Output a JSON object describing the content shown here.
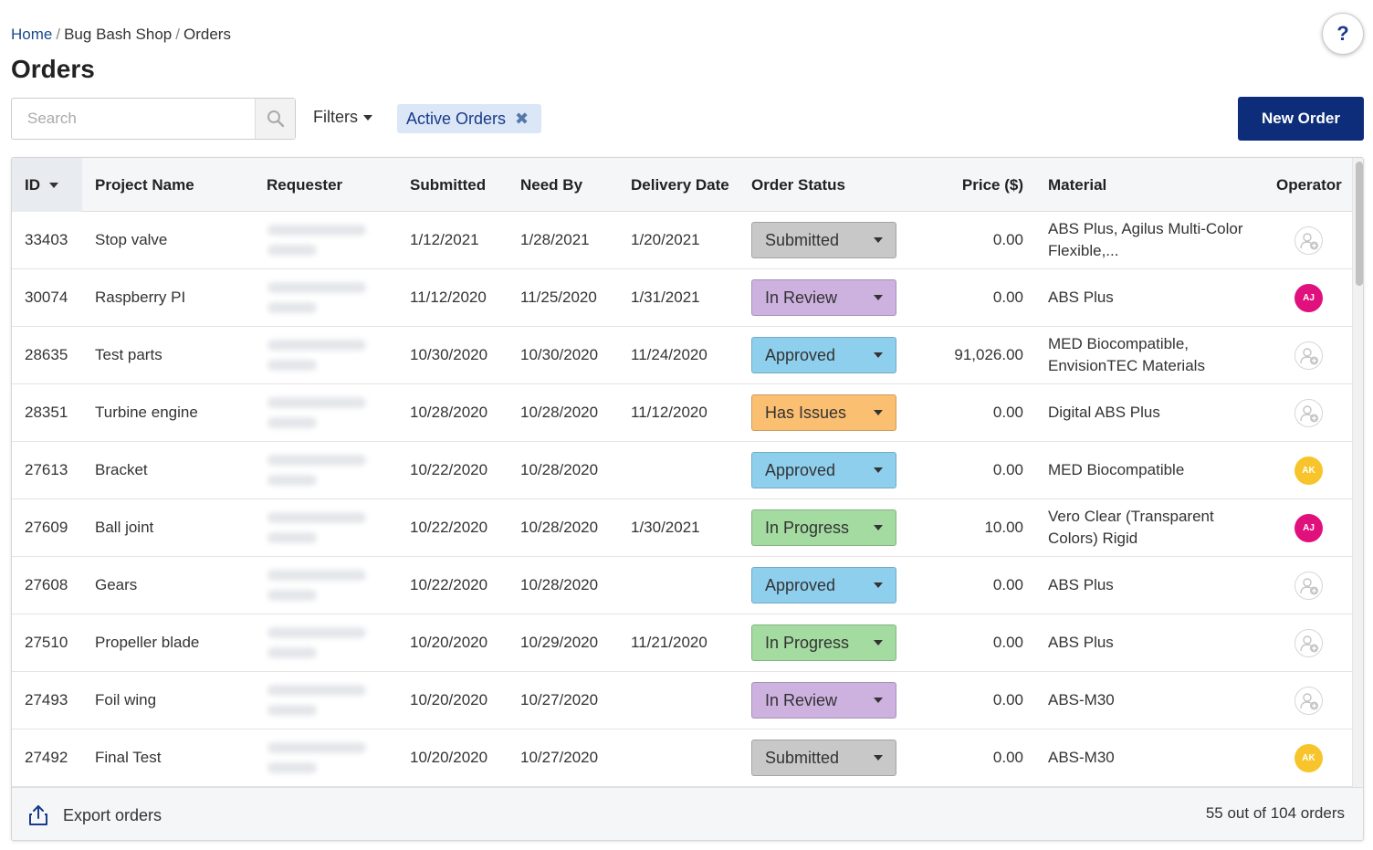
{
  "breadcrumb": {
    "home": "Home",
    "shop": "Bug Bash Shop",
    "current": "Orders",
    "separator": "/"
  },
  "page_title": "Orders",
  "help_label": "?",
  "search": {
    "placeholder": "Search",
    "value": ""
  },
  "filters_label": "Filters",
  "active_filter": {
    "label": "Active Orders",
    "remove_label": "✖"
  },
  "new_order_label": "New Order",
  "columns": {
    "id": "ID",
    "project": "Project Name",
    "requester": "Requester",
    "submitted": "Submitted",
    "need_by": "Need By",
    "delivery": "Delivery Date",
    "status": "Order Status",
    "price": "Price ($)",
    "material": "Material",
    "operator": "Operator"
  },
  "status_colors": {
    "Submitted": "#c8c8c8",
    "In Review": "#cdb1df",
    "Approved": "#8fcfee",
    "Has Issues": "#fbbf72",
    "In Progress": "#a3dba0"
  },
  "operator_colors": {
    "AJ": "#e0107c",
    "AK": "#f7c52b"
  },
  "rows": [
    {
      "id": "33403",
      "project": "Stop valve",
      "submitted": "1/12/2021",
      "need_by": "1/28/2021",
      "delivery": "1/20/2021",
      "status": "Submitted",
      "price": "0.00",
      "material": "ABS Plus, Agilus Multi-Color Flexible,...",
      "operator": ""
    },
    {
      "id": "30074",
      "project": "Raspberry PI",
      "submitted": "11/12/2020",
      "need_by": "11/25/2020",
      "delivery": "1/31/2021",
      "status": "In Review",
      "price": "0.00",
      "material": "ABS Plus",
      "operator": "AJ"
    },
    {
      "id": "28635",
      "project": "Test parts",
      "submitted": "10/30/2020",
      "need_by": "10/30/2020",
      "delivery": "11/24/2020",
      "status": "Approved",
      "price": "91,026.00",
      "material": "MED Biocompatible, EnvisionTEC Materials",
      "operator": ""
    },
    {
      "id": "28351",
      "project": "Turbine engine",
      "submitted": "10/28/2020",
      "need_by": "10/28/2020",
      "delivery": "11/12/2020",
      "status": "Has Issues",
      "price": "0.00",
      "material": "Digital ABS Plus",
      "operator": ""
    },
    {
      "id": "27613",
      "project": "Bracket",
      "submitted": "10/22/2020",
      "need_by": "10/28/2020",
      "delivery": "",
      "status": "Approved",
      "price": "0.00",
      "material": "MED Biocompatible",
      "operator": "AK"
    },
    {
      "id": "27609",
      "project": "Ball joint",
      "submitted": "10/22/2020",
      "need_by": "10/28/2020",
      "delivery": "1/30/2021",
      "status": "In Progress",
      "price": "10.00",
      "material": "Vero Clear (Transparent Colors) Rigid",
      "operator": "AJ"
    },
    {
      "id": "27608",
      "project": "Gears",
      "submitted": "10/22/2020",
      "need_by": "10/28/2020",
      "delivery": "",
      "status": "Approved",
      "price": "0.00",
      "material": "ABS Plus",
      "operator": ""
    },
    {
      "id": "27510",
      "project": "Propeller blade",
      "submitted": "10/20/2020",
      "need_by": "10/29/2020",
      "delivery": "11/21/2020",
      "status": "In Progress",
      "price": "0.00",
      "material": "ABS Plus",
      "operator": ""
    },
    {
      "id": "27493",
      "project": "Foil wing",
      "submitted": "10/20/2020",
      "need_by": "10/27/2020",
      "delivery": "",
      "status": "In Review",
      "price": "0.00",
      "material": "ABS-M30",
      "operator": ""
    },
    {
      "id": "27492",
      "project": "Final Test",
      "submitted": "10/20/2020",
      "need_by": "10/27/2020",
      "delivery": "",
      "status": "Submitted",
      "price": "0.00",
      "material": "ABS-M30",
      "operator": "AK"
    }
  ],
  "footer": {
    "export_label": "Export orders",
    "count_text": "55 out of 104 orders"
  },
  "icons": {
    "search": "search-icon",
    "help": "help-icon",
    "export": "export-icon",
    "add_operator": "add-operator-icon",
    "sort": "sort-caret-icon",
    "dropdown": "caret-down-icon"
  }
}
